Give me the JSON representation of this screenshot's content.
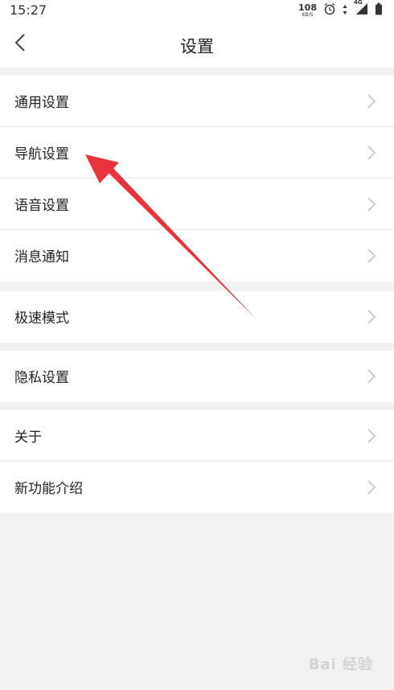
{
  "status_bar": {
    "time": "15:27",
    "net_speed_value": "108",
    "net_speed_unit": "KB/S",
    "network_type": "4G",
    "icons": [
      "alarm-icon",
      "data-arrows-icon",
      "signal-icon",
      "battery-icon"
    ]
  },
  "header": {
    "title": "设置",
    "back_icon": "chevron-left-icon"
  },
  "groups": [
    {
      "items": [
        {
          "label": "通用设置"
        },
        {
          "label": "导航设置"
        },
        {
          "label": "语音设置"
        },
        {
          "label": "消息通知"
        }
      ]
    },
    {
      "items": [
        {
          "label": "极速模式"
        }
      ]
    },
    {
      "items": [
        {
          "label": "隐私设置"
        }
      ]
    },
    {
      "items": [
        {
          "label": "关于"
        },
        {
          "label": "新功能介绍"
        }
      ]
    }
  ],
  "row_chevron_icon": "chevron-right-icon",
  "annotation": {
    "color": "#e8333a",
    "points_to": "导航设置"
  },
  "watermark": {
    "text": "Bai 经验"
  },
  "colors": {
    "background": "#f2f2f2",
    "surface": "#ffffff",
    "divider": "#e6e6e6",
    "text": "#222222",
    "chevron": "#c4c4c4"
  }
}
